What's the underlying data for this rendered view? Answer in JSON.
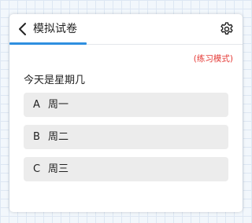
{
  "header": {
    "back_icon": "chevron-left-icon",
    "title": "模拟试卷",
    "settings_icon": "gear-icon",
    "accent_color": "#2f8fe0"
  },
  "mode_label": "(练习模式)",
  "mode_color": "#e53935",
  "question": {
    "text": "今天是星期几",
    "options": [
      {
        "key": "A",
        "text": "周一"
      },
      {
        "key": "B",
        "text": "周二"
      },
      {
        "key": "C",
        "text": "周三"
      }
    ]
  }
}
